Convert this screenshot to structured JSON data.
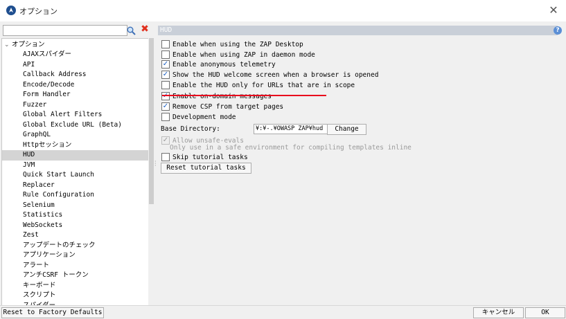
{
  "window": {
    "title": "オプション"
  },
  "search": {
    "value": "",
    "placeholder": ""
  },
  "tree": {
    "root_label": "オプション",
    "items": [
      "AJAXスパイダー",
      "API",
      "Callback Address",
      "Encode/Decode",
      "Form Handler",
      "Fuzzer",
      "Global Alert Filters",
      "Global Exclude URL (Beta)",
      "GraphQL",
      "Httpセッション",
      "HUD",
      "JVM",
      "Quick Start Launch",
      "Replacer",
      "Rule Configuration",
      "Selenium",
      "Statistics",
      "WebSockets",
      "Zest",
      "アップデートのチェック",
      "アプリケーション",
      "アラート",
      "アンチCSRF トークン",
      "キーボード",
      "スクリプト",
      "スパイダー"
    ],
    "selected_index": 10
  },
  "panel": {
    "header": "HUD",
    "options": [
      {
        "label": "Enable when using the ZAP Desktop",
        "checked": false
      },
      {
        "label": "Enable when using ZAP in daemon mode",
        "checked": false
      },
      {
        "label": "Enable anonymous telemetry",
        "checked": true
      },
      {
        "label": "Show the HUD welcome screen when a browser is opened",
        "checked": true
      },
      {
        "label": "Enable the HUD only for URLs that are in scope",
        "checked": false
      },
      {
        "label": "Enable on-domain messages",
        "checked": true
      },
      {
        "label": "Remove CSP from target pages",
        "checked": true
      },
      {
        "label": "Development mode",
        "checked": false
      }
    ],
    "base_directory_label": "Base Directory:",
    "base_directory_value": "¥:¥-.¥OWASP ZAP¥hud",
    "change_button": "Change",
    "unsafe_evals_label": "Allow unsafe-evals",
    "unsafe_evals_note": "Only use in a safe environment for compiling templates inline",
    "unsafe_evals_checked": true,
    "skip_tutorial_label": "Skip tutorial tasks",
    "skip_tutorial_checked": false,
    "reset_tutorial_button": "Reset tutorial tasks"
  },
  "footer": {
    "reset_defaults": "Reset to Factory Defaults",
    "cancel": "キャンセル",
    "ok": "OK"
  },
  "colors": {
    "highlight_underline": "#e8001c",
    "header_bg": "#c9cfd8",
    "selected_row": "#d4d4d4"
  }
}
